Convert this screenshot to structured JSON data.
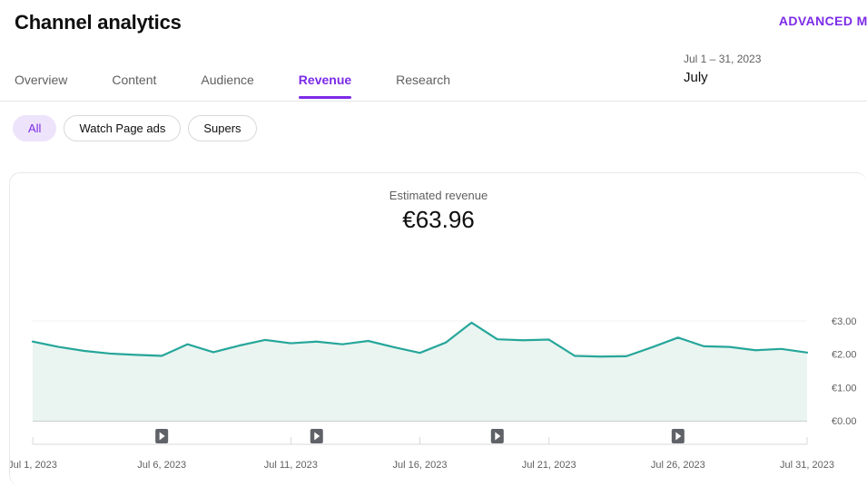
{
  "header": {
    "title": "Channel analytics",
    "advanced_mode_label": "ADVANCED MO",
    "date_range": "Jul 1 – 31, 2023",
    "date_month": "July"
  },
  "tabs": [
    {
      "label": "Overview",
      "active": false
    },
    {
      "label": "Content",
      "active": false
    },
    {
      "label": "Audience",
      "active": false
    },
    {
      "label": "Revenue",
      "active": true
    },
    {
      "label": "Research",
      "active": false
    }
  ],
  "chips": [
    {
      "label": "All",
      "selected": true
    },
    {
      "label": "Watch Page ads",
      "selected": false
    },
    {
      "label": "Supers",
      "selected": false
    }
  ],
  "card": {
    "metric_label": "Estimated revenue",
    "metric_value": "€63.96"
  },
  "colors": {
    "accent_purple": "#7c2ae8",
    "chip_selected_bg": "#ede4fb",
    "line_teal": "#26a69a",
    "area_fill": "#eaf5f1",
    "gridline": "#f0f0f0",
    "baseline": "#9e9e9e",
    "marker_gray": "#5f6368",
    "text_primary": "#0f0f0f",
    "text_secondary": "#606060"
  },
  "chart_data": {
    "type": "area",
    "title": "Estimated revenue",
    "xlabel": "",
    "ylabel": "",
    "ylim": [
      0,
      3
    ],
    "yticks": [
      0,
      1,
      2,
      3
    ],
    "ytick_labels": [
      "€0.00",
      "€1.00",
      "€2.00",
      "€3.00"
    ],
    "grid": true,
    "legend": "none",
    "x": [
      "Jul 1, 2023",
      "Jul 2, 2023",
      "Jul 3, 2023",
      "Jul 4, 2023",
      "Jul 5, 2023",
      "Jul 6, 2023",
      "Jul 7, 2023",
      "Jul 8, 2023",
      "Jul 9, 2023",
      "Jul 10, 2023",
      "Jul 11, 2023",
      "Jul 12, 2023",
      "Jul 13, 2023",
      "Jul 14, 2023",
      "Jul 15, 2023",
      "Jul 16, 2023",
      "Jul 17, 2023",
      "Jul 18, 2023",
      "Jul 19, 2023",
      "Jul 20, 2023",
      "Jul 21, 2023",
      "Jul 22, 2023",
      "Jul 23, 2023",
      "Jul 24, 2023",
      "Jul 25, 2023",
      "Jul 26, 2023",
      "Jul 27, 2023",
      "Jul 28, 2023",
      "Jul 29, 2023",
      "Jul 30, 2023",
      "Jul 31, 2023"
    ],
    "xtick_labels": [
      "Jul 1, 2023",
      "Jul 6, 2023",
      "Jul 11, 2023",
      "Jul 16, 2023",
      "Jul 21, 2023",
      "Jul 26, 2023",
      "Jul 31, 2023"
    ],
    "xtick_indices": [
      0,
      5,
      10,
      15,
      20,
      25,
      30
    ],
    "series": [
      {
        "name": "Estimated revenue",
        "values": [
          2.38,
          2.22,
          2.1,
          2.02,
          1.98,
          1.95,
          2.3,
          2.06,
          2.26,
          2.43,
          2.33,
          2.38,
          2.3,
          2.4,
          2.21,
          2.04,
          2.35,
          2.95,
          2.45,
          2.42,
          2.44,
          1.95,
          1.93,
          1.94,
          2.21,
          2.5,
          2.24,
          2.22,
          2.12,
          2.16,
          2.05
        ]
      }
    ],
    "video_markers": [
      {
        "index": 5,
        "label": "video-marker"
      },
      {
        "index": 11,
        "label": "video-marker"
      },
      {
        "index": 18,
        "label": "video-marker"
      },
      {
        "index": 25,
        "label": "video-marker"
      }
    ]
  }
}
